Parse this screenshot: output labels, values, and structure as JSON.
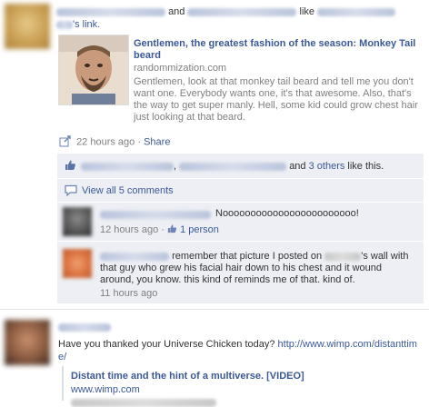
{
  "story1": {
    "conj_and": "and",
    "verb_like": "like",
    "link_suffix": "'s link.",
    "attachment": {
      "title": "Gentlemen, the greatest fashion of the season: Monkey Tail beard",
      "domain": "randommization.com",
      "description": "Gentlemen, look at that monkey tail beard and tell me you don't want one. Everybody wants one, it's that awesome. Also, that's the way to get super manly. Hell, some kid could grow chest hair just looking at that beard."
    },
    "timestamp": "22 hours ago",
    "dot": "·",
    "share_label": "Share",
    "likes": {
      "comma": ",",
      "and": "and",
      "others_link": "3 others",
      "suffix": "like this."
    },
    "view_all_comments": "View all 5 comments",
    "comments": [
      {
        "text": "Noooooooooooooooooooooooo!",
        "time": "12 hours ago",
        "likes_link": "1 person"
      },
      {
        "text_part1": "remember that picture I posted on",
        "text_part2": "'s wall with that guy who grew his facial hair down to his chest and it wound around, you know. this kind of reminds me of that. kind of.",
        "time": "11 hours ago"
      }
    ]
  },
  "story2": {
    "text": "Have you thanked your Universe Chicken today?",
    "url": "http://www.wimp.com/distanttime/",
    "attachment": {
      "title": "Distant time and the hint of a multiverse. [VIDEO]",
      "domain": "www.wimp.com"
    }
  },
  "colors": {
    "link": "#3b5998",
    "meta_gray": "#808080",
    "ufi_background": "#edeff4"
  },
  "icons": [
    "share-icon",
    "thumbs-up-icon",
    "comment-icon",
    "like-small-icon"
  ]
}
